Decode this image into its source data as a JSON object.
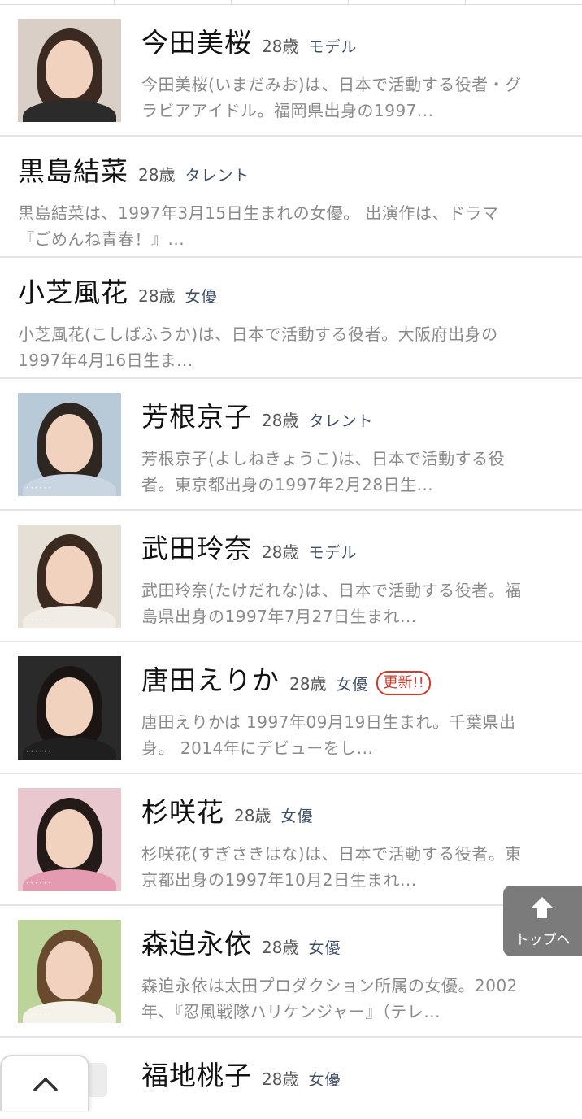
{
  "items": [
    {
      "name": "今田美桜",
      "age": "28歳",
      "category": "モデル",
      "desc": [
        "今田美桜(いまだみお)は、日本で活動する役者・グ",
        "ラビアアイドル。福岡県出身の1997..."
      ],
      "has_photo": true
    },
    {
      "name": "黒島結菜",
      "age": "28歳",
      "category": "タレント",
      "desc": [
        "黒島結菜は、1997年3月15日生まれの女優。 出演作は、ドラマ",
        "『ごめんね青春！』..."
      ],
      "has_photo": false
    },
    {
      "name": "小芝風花",
      "age": "28歳",
      "category": "女優",
      "desc": [
        "小芝風花(こしばふうか)は、日本で活動する役者。大阪府出身の",
        "1997年4月16日生ま..."
      ],
      "has_photo": false
    },
    {
      "name": "芳根京子",
      "age": "28歳",
      "category": "タレント",
      "desc": [
        "芳根京子(よしねきょうこ)は、日本で活動する役",
        "者。東京都出身の1997年2月28日生..."
      ],
      "has_photo": true
    },
    {
      "name": "武田玲奈",
      "age": "28歳",
      "category": "モデル",
      "desc": [
        "武田玲奈(たけだれな)は、日本で活動する役者。福",
        "島県出身の1997年7月27日生まれ..."
      ],
      "has_photo": true
    },
    {
      "name": "唐田えりか",
      "age": "28歳",
      "category": "女優",
      "badge": "更新!!",
      "desc": [
        "唐田えりかは 1997年09月19日生まれ。千葉県出",
        "身。 2014年にデビューをし..."
      ],
      "has_photo": true
    },
    {
      "name": "杉咲花",
      "age": "28歳",
      "category": "女優",
      "desc": [
        "杉咲花(すぎさきはな)は、日本で活動する役者。東",
        "京都出身の1997年10月2日生まれ..."
      ],
      "has_photo": true
    },
    {
      "name": "森迫永依",
      "age": "28歳",
      "category": "女優",
      "desc": [
        "森迫永依は太田プロダクション所属の女優。2002",
        "年、『忍風戦隊ハリケンジャー』（テレ..."
      ],
      "has_photo": true
    },
    {
      "name": "福地桃子",
      "age": "28歳",
      "category": "女優"
    }
  ],
  "back_to_top": {
    "label": "トップへ",
    "icon": "arrow-up-icon"
  },
  "collapse_tab": {
    "icon": "chevron-up-icon"
  },
  "colors": {
    "badge": "#d63a2b",
    "category": "#3f4f67",
    "desc": "#8a8a8a",
    "top_button": "#7b7b7b"
  }
}
